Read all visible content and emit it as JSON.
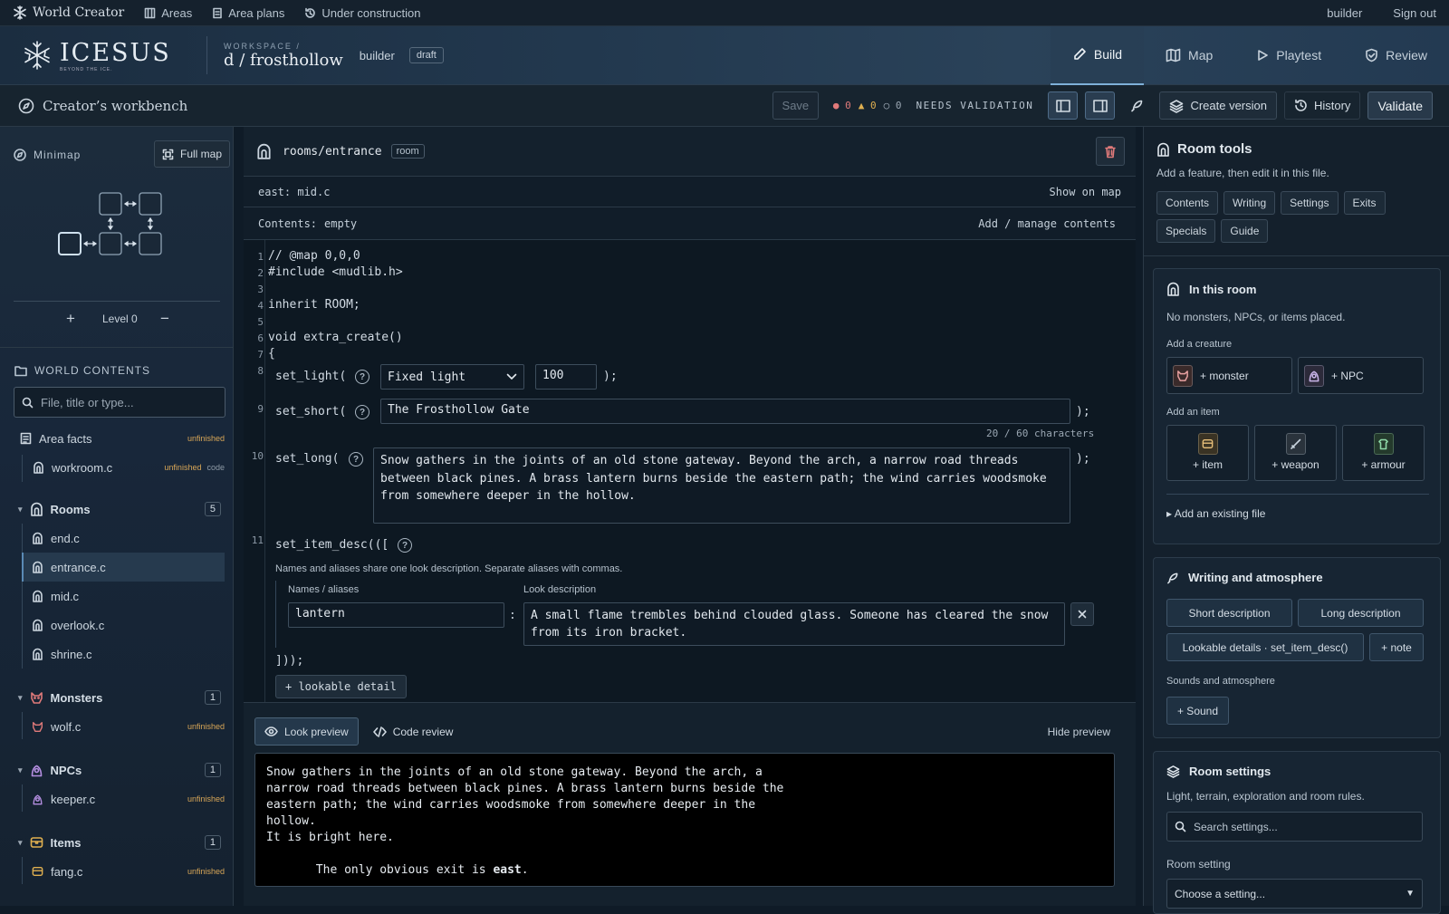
{
  "topbar": {
    "brand": "World Creator",
    "items": [
      "Areas",
      "Area plans",
      "Under construction"
    ],
    "user": "builder",
    "signout": "Sign out"
  },
  "header": {
    "logo_text": "ICESUS",
    "logo_sub": "BEYOND THE ICE.",
    "workspace_label": "WORKSPACE /",
    "workspace_name": "d / frosthollow",
    "user": "builder",
    "badge": "draft",
    "tabs": [
      "Build",
      "Map",
      "Playtest",
      "Review"
    ]
  },
  "toolbar": {
    "title": "Creator’s workbench",
    "save": "Save",
    "errors": "0",
    "warnings": "0",
    "infos": "0",
    "status": "NEEDS VALIDATION",
    "create_version": "Create version",
    "history": "History",
    "validate": "Validate"
  },
  "left": {
    "minimap_label": "Minimap",
    "full_map": "Full map",
    "level": "Level 0",
    "contents_label": "WORLD CONTENTS",
    "search_placeholder": "File, title or type...",
    "area_facts": "Area facts",
    "area_facts_tag": "unfinished",
    "workroom": "workroom.c",
    "workroom_tag": "unfinished",
    "workroom_tag2": "code",
    "rooms_label": "Rooms",
    "rooms_count": "5",
    "rooms": [
      "end.c",
      "entrance.c",
      "mid.c",
      "overlook.c",
      "shrine.c"
    ],
    "monsters_label": "Monsters",
    "monsters_count": "1",
    "monster": "wolf.c",
    "monster_tag": "unfinished",
    "npcs_label": "NPCs",
    "npcs_count": "1",
    "npc": "keeper.c",
    "npc_tag": "unfinished",
    "items_label": "Items",
    "items_count": "1",
    "item": "fang.c",
    "item_tag": "unfinished"
  },
  "editor": {
    "path": "rooms/entrance",
    "kind": "room",
    "exit": "east: mid.c",
    "show_on_map": "Show on map",
    "contents_label": "Contents:",
    "contents_value": "empty",
    "manage": "Add / manage contents",
    "lines": [
      "// @map 0,0,0",
      "#include <mudlib.h>",
      "",
      "inherit ROOM;",
      "",
      "void extra_create()",
      "{"
    ],
    "set_light": "set_light",
    "light_mode": "Fixed light",
    "light_value": "100",
    "close_paren": ");",
    "set_short": "set_short",
    "short_value": "The Frosthollow Gate",
    "short_count": "20 / 60 characters",
    "set_long": "set_long",
    "long_value": "Snow gathers in the joints of an old stone gateway. Beyond the arch, a narrow road threads between black pines. A brass lantern burns beside the eastern path; the wind carries woodsmoke from somewhere deeper in the hollow.",
    "set_item_desc": "set_item_desc",
    "item_desc_open": "(([",
    "item_desc_hint": "Names and aliases share one look description. Separate aliases with commas.",
    "names_label": "Names / aliases",
    "look_label": "Look description",
    "names_value": "lantern",
    "look_value": "A small flame trembles behind clouded glass. Someone has cleared the snow from its iron bracket.",
    "item_desc_close": "]));",
    "add_detail": "+ lookable detail"
  },
  "preview": {
    "look_tab": "Look preview",
    "code_tab": "Code review",
    "hide": "Hide preview",
    "lines": [
      "Snow gathers in the joints of an old stone gateway. Beyond the arch, a",
      "narrow road threads between black pines. A brass lantern burns beside the",
      "eastern path; the wind carries woodsmoke from somewhere deeper in the",
      "hollow.",
      "It is bright here."
    ],
    "exit_prefix": "       The only obvious exit is ",
    "exit_word": "east",
    "exit_suffix": "."
  },
  "right": {
    "title": "Room tools",
    "subtitle": "Add a feature, then edit it in this file.",
    "tabs": [
      "Contents",
      "Writing",
      "Settings",
      "Exits",
      "Specials",
      "Guide"
    ],
    "in_room_title": "In this room",
    "in_room_text": "No monsters, NPCs, or items placed.",
    "add_creature": "Add a creature",
    "monster_btn": "+ monster",
    "npc_btn": "+ NPC",
    "add_item": "Add an item",
    "item_btn": "+ item",
    "weapon_btn": "+ weapon",
    "armour_btn": "+ armour",
    "existing": "Add an existing file",
    "writing_title": "Writing and atmosphere",
    "short_btn": "Short description",
    "long_btn": "Long description",
    "details_btn": "Lookable details · set_item_desc()",
    "note_btn": "+ note",
    "sounds_label": "Sounds and atmosphere",
    "sound_btn": "+ Sound",
    "settings_title": "Room settings",
    "settings_text": "Light, terrain, exploration and room rules.",
    "settings_placeholder": "Search settings...",
    "room_setting_label": "Room setting",
    "room_setting_value": "Choose a setting..."
  }
}
